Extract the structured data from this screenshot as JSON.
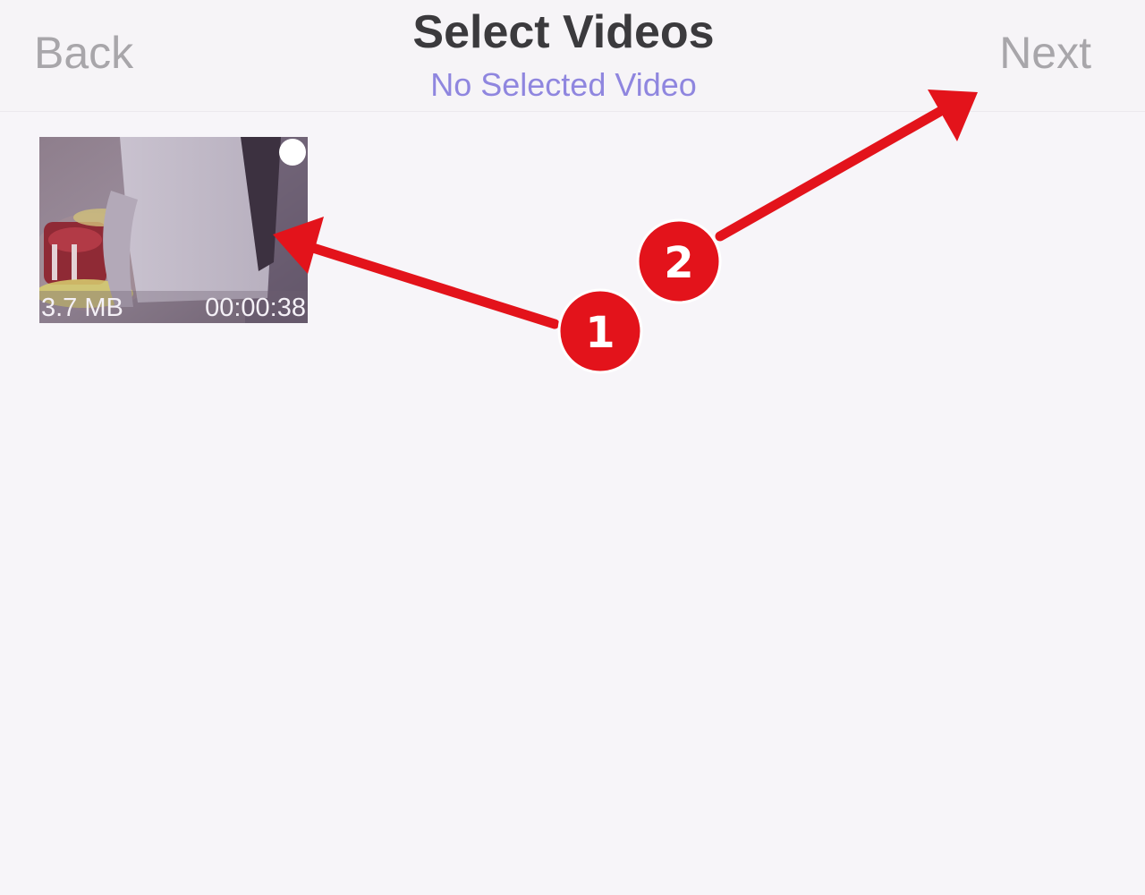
{
  "navbar": {
    "back_label": "Back",
    "title": "Select Videos",
    "subtitle": "No Selected Video",
    "next_label": "Next"
  },
  "videos": [
    {
      "size": "3.7 MB",
      "duration": "00:00:38"
    }
  ],
  "annotations": {
    "step1": "1",
    "step2": "2",
    "color": "#e3131b"
  },
  "colors": {
    "background": "#f7f5f9",
    "nav_text_disabled": "#a8a6aa",
    "title_text": "#3b3a3d",
    "subtitle_text": "#8f86df"
  }
}
